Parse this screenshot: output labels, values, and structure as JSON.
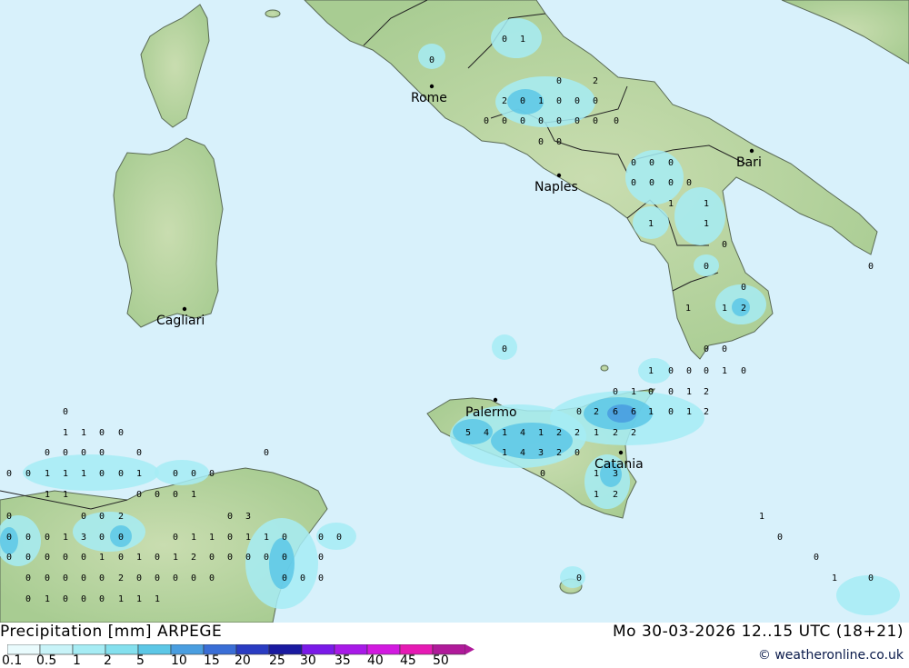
{
  "map": {
    "cities": [
      {
        "name": "Rome"
      },
      {
        "name": "Naples"
      },
      {
        "name": "Bari"
      },
      {
        "name": "Cagliari"
      },
      {
        "name": "Palermo"
      },
      {
        "name": "Catania"
      }
    ],
    "values": [
      "0",
      "1",
      "0",
      "0",
      "2",
      "2",
      "0",
      "1",
      "0",
      "0",
      "0",
      "0",
      "0",
      "0",
      "0",
      "0",
      "0",
      "0",
      "0",
      "0",
      "0",
      "0",
      "0",
      "0",
      "0",
      "0",
      "0",
      "0",
      "1",
      "1",
      "1",
      "1",
      "0",
      "0",
      "0",
      "0",
      "2",
      "1",
      "1",
      "0",
      "0",
      "0",
      "1",
      "0",
      "0",
      "0",
      "1",
      "0",
      "0",
      "1",
      "0",
      "0",
      "1",
      "2",
      "0",
      "2",
      "6",
      "6",
      "1",
      "0",
      "1",
      "2",
      "5",
      "4",
      "1",
      "4",
      "1",
      "2",
      "2",
      "1",
      "2",
      "2",
      "1",
      "4",
      "3",
      "2",
      "0",
      "1",
      "3",
      "0",
      "1",
      "2",
      "0",
      "1",
      "1",
      "0",
      "0",
      "0",
      "0",
      "0",
      "0",
      "0",
      "0",
      "0",
      "0",
      "1",
      "1",
      "1",
      "0",
      "0",
      "1",
      "0",
      "0",
      "0",
      "1",
      "1",
      "0",
      "0",
      "0",
      "1",
      "0",
      "0",
      "0",
      "2",
      "0",
      "3",
      "1",
      "0",
      "0",
      "0",
      "1",
      "3",
      "0",
      "0",
      "0",
      "1",
      "1",
      "0",
      "1",
      "1",
      "0",
      "0",
      "0",
      "0",
      "0",
      "0",
      "0",
      "0",
      "0",
      "1",
      "0",
      "1",
      "0",
      "1",
      "2",
      "0",
      "0",
      "0",
      "0",
      "0",
      "0",
      "0",
      "0",
      "0",
      "0",
      "0",
      "0",
      "2",
      "0",
      "0",
      "0",
      "0",
      "0",
      "0",
      "0",
      "0",
      "0",
      "1",
      "0",
      "0",
      "1",
      "0",
      "0",
      "0",
      "1",
      "1",
      "1"
    ]
  },
  "footer": {
    "title": "Precipitation [mm] ARPEGE",
    "datetime": "Mo 30-03-2026 12..15 UTC (18+21)",
    "credit": "© weatheronline.co.uk"
  },
  "legend": {
    "labels": [
      "0.1",
      "0.5",
      "1",
      "2",
      "5",
      "10",
      "15",
      "20",
      "25",
      "30",
      "35",
      "40",
      "45",
      "50"
    ],
    "colors": [
      "#e9fbfd",
      "#c8f3f8",
      "#a6ecf4",
      "#84e0ee",
      "#5cc7e6",
      "#4a9ee0",
      "#3a6ed6",
      "#2a3cc2",
      "#1a1aa0",
      "#7a1ae8",
      "#a81ae8",
      "#d21ae0",
      "#e61ab4",
      "#b01a9a"
    ]
  },
  "colors": {
    "sea": "#d8f1fb",
    "land": "#b8d7a0",
    "precip_light": "#a6ecf4",
    "precip_mid": "#5cc7e6",
    "precip_heavy": "#4a9ee0"
  }
}
